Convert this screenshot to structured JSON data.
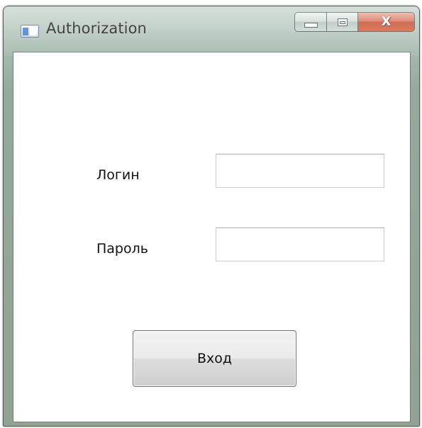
{
  "window": {
    "title": "Authorization",
    "controls": {
      "minimize_icon": "minimize-icon",
      "maximize_icon": "maximize-icon",
      "close_icon": "close-icon",
      "close_glyph": "X"
    }
  },
  "form": {
    "login_label": "Логин",
    "login_value": "",
    "password_label": "Пароль",
    "password_value": "",
    "submit_label": "Вход"
  },
  "colors": {
    "close_button": "#c9452a",
    "titlebar": "#a8bdb2"
  }
}
